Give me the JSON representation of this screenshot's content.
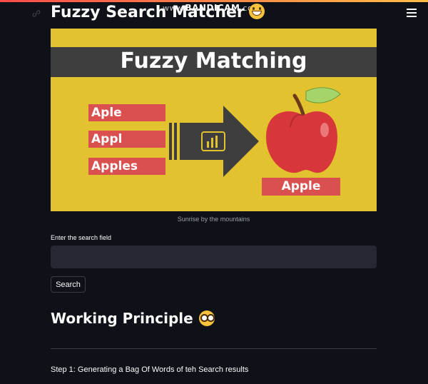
{
  "watermark": {
    "brand": "BANDICAM",
    "prefix": "www.",
    "suffix": ".com"
  },
  "page": {
    "title": "Fuzzy Search Matcher"
  },
  "hero": {
    "title": "Fuzzy Matching",
    "inputs": [
      "Aple",
      "Appl",
      "Apples"
    ],
    "result": "Apple",
    "caption": "Sunrise by the mountains"
  },
  "search": {
    "label": "Enter the search field",
    "value": "",
    "button": "Search"
  },
  "principle": {
    "heading": "Working Principle",
    "step1": "Step 1: Generating a Bag Of Words of teh Search results"
  },
  "colors": {
    "background": "#0e1117",
    "accent": "#ff4b4b",
    "input_bg": "#262730",
    "hero_bg": "#e3c22f",
    "tag_red": "#d9504f"
  }
}
